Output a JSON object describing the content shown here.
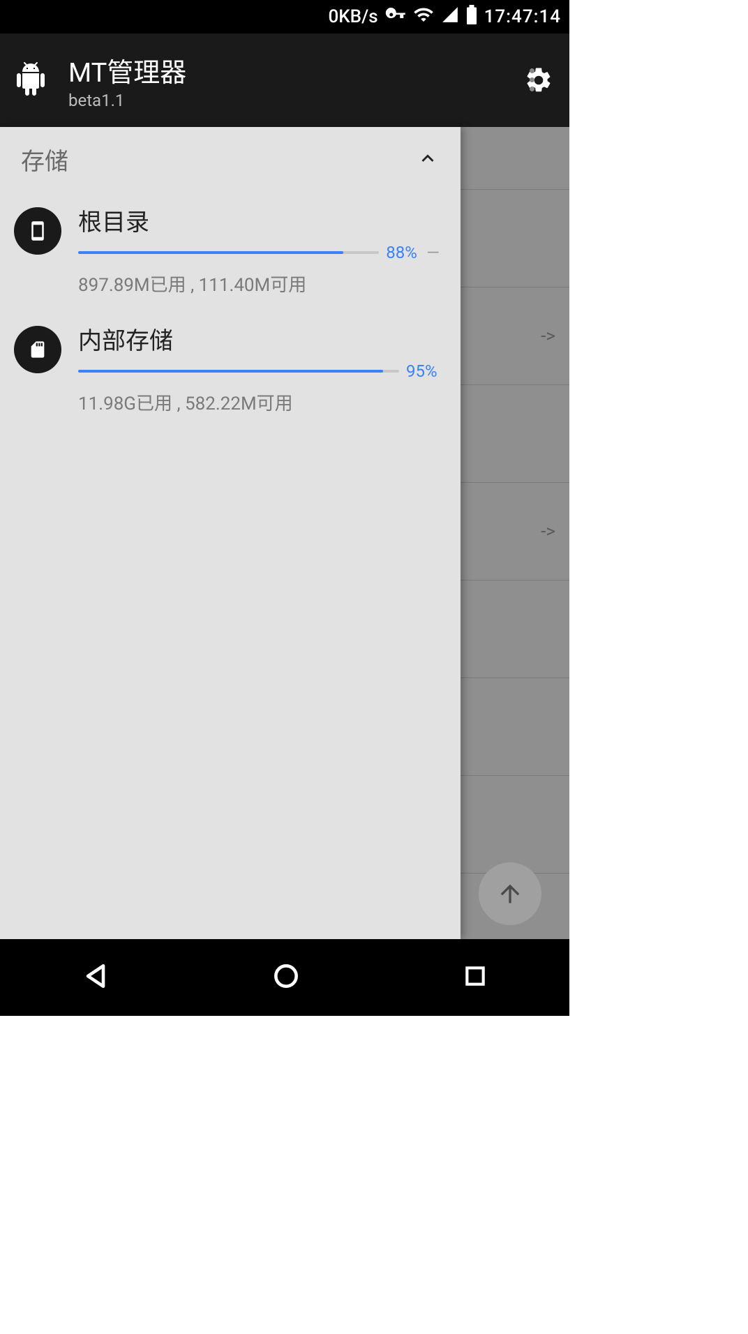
{
  "status": {
    "speed": "0KB/s",
    "time": "17:47:14"
  },
  "header": {
    "title": "MT管理器",
    "subtitle": "beta1.1"
  },
  "drawer": {
    "section_label": "存储",
    "items": [
      {
        "title": "根目录",
        "percent_label": "88%",
        "percent": 88,
        "detail": "897.89M已用 , 111.40M可用"
      },
      {
        "title": "内部存储",
        "percent_label": "95%",
        "percent": 95,
        "detail": "11.98G已用 , 582.22M可用"
      }
    ]
  },
  "background": {
    "arrow1": "->",
    "arrow2": "->"
  }
}
